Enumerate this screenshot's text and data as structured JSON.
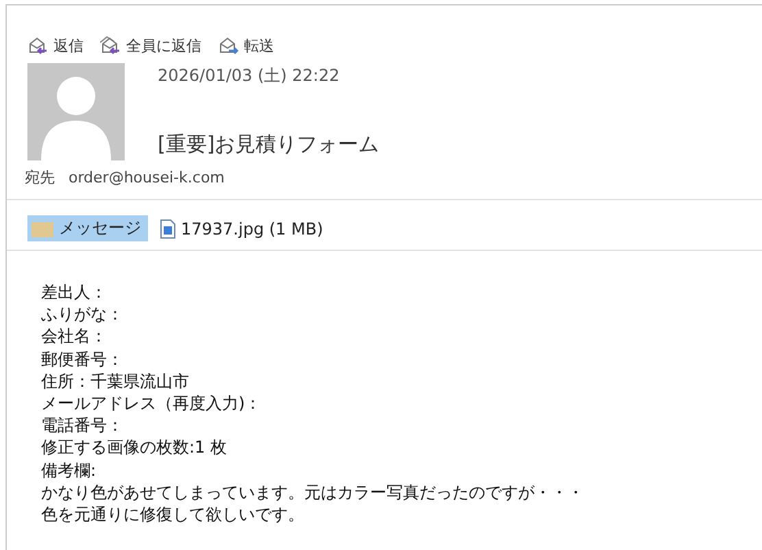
{
  "toolbar": [
    {
      "label": "返信",
      "kind": "reply"
    },
    {
      "label": "全員に返信",
      "kind": "reply_all"
    },
    {
      "label": "転送",
      "kind": "forward"
    }
  ],
  "message": {
    "date": "2026/01/03 (土) 22:22",
    "subject": "[重要]お見積りフォーム",
    "to_label": "宛先",
    "to": "order@housei-k.com"
  },
  "attachments": [
    {
      "label": "メッセージ",
      "kind": "message",
      "selected": true
    },
    {
      "label": "17937.jpg (1 MB)",
      "kind": "file",
      "selected": false
    }
  ],
  "body": [
    "差出人：",
    "ふりがな：",
    "会社名：",
    "郵便番号：",
    "住所：千葉県流山市",
    "メールアドレス（再度入力)：",
    "電話番号：",
    "修正する画像の枚数:1 枚",
    "備考欄:",
    "かなり色があせてしまっています。元はカラー写真だったのですが・・・",
    "色を元通りに修復して欲しいです。"
  ]
}
